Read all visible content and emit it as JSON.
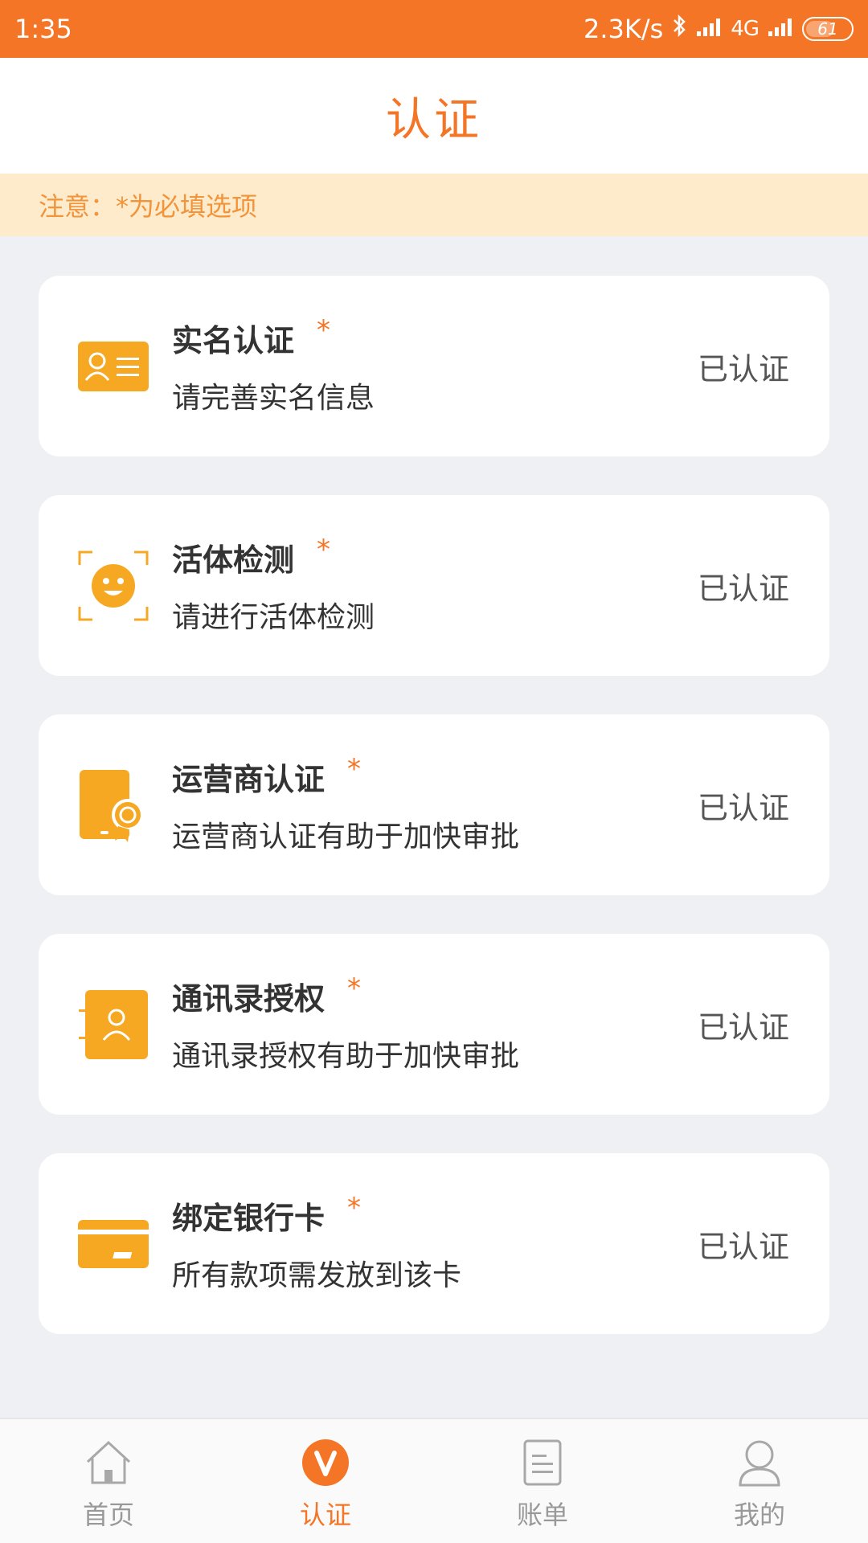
{
  "status_bar": {
    "time": "1:35",
    "net_speed": "2.3K/s",
    "network": "4G",
    "battery": "61"
  },
  "header": {
    "title": "认证"
  },
  "notice": {
    "text": "注意：*为必填选项"
  },
  "colors": {
    "accent": "#f47526",
    "icon": "#f7a823",
    "notice_bg": "#fdebcb",
    "page_bg": "#eef0f4"
  },
  "cards": [
    {
      "icon": "id-card-icon",
      "title": "实名认证",
      "star": "*",
      "subtitle": "请完善实名信息",
      "status": "已认证"
    },
    {
      "icon": "face-scan-icon",
      "title": "活体检测",
      "star": "*",
      "subtitle": "请进行活体检测",
      "status": "已认证"
    },
    {
      "icon": "phone-badge-icon",
      "title": "运营商认证",
      "star": "*",
      "subtitle": "运营商认证有助于加快审批",
      "status": "已认证"
    },
    {
      "icon": "contacts-icon",
      "title": "通讯录授权",
      "star": "*",
      "subtitle": "通讯录授权有助于加快审批",
      "status": "已认证"
    },
    {
      "icon": "bank-card-icon",
      "title": "绑定银行卡",
      "star": "*",
      "subtitle": "所有款项需发放到该卡",
      "status": "已认证"
    }
  ],
  "bottom_nav": {
    "items": [
      {
        "label": "首页",
        "icon": "home-icon"
      },
      {
        "label": "认证",
        "icon": "verify-v-icon",
        "active": true
      },
      {
        "label": "账单",
        "icon": "bill-icon"
      },
      {
        "label": "我的",
        "icon": "profile-icon"
      }
    ]
  }
}
